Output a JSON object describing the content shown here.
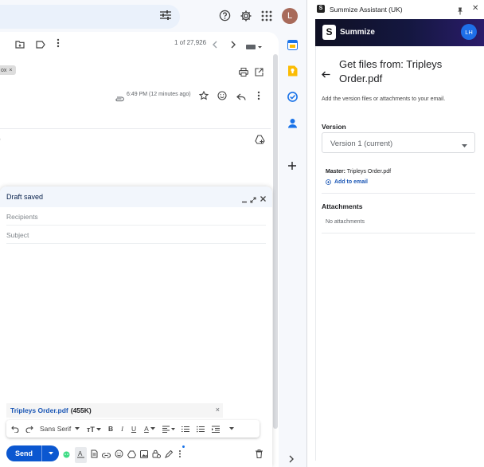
{
  "gmail": {
    "avatar_letter": "L",
    "pager": "1 of 27,926",
    "label_chip": "ox",
    "time": "6:49 PM (12 minutes ago)",
    "paren": ")"
  },
  "compose": {
    "title": "Draft saved",
    "recipients_placeholder": "Recipients",
    "subject_placeholder": "Subject",
    "attachment_name": "Tripleys Order.pdf",
    "attachment_size": "(455K)",
    "font_name": "Sans Serif",
    "send_label": "Send"
  },
  "panel": {
    "title": "Summize Assistant (UK)",
    "brand": "Summize",
    "user_initials": "LH",
    "heading": "Get files from: Tripleys Order.pdf",
    "hint": "Add the version files or attachments to your email.",
    "version_label": "Version",
    "version_value": "Version 1 (current)",
    "master_label": "Master:",
    "master_file": "Tripleys Order.pdf",
    "add_to_email": "Add to email",
    "attachments_label": "Attachments",
    "no_attachments": "No attachments"
  },
  "colors": {
    "send": "#0b57d0",
    "link": "#1a56b5",
    "banner_dark": "#141740",
    "banner_purple": "#2b1c6b",
    "avatar_gmail": "#a86a5a",
    "avatar_panel": "#1e6fe8"
  }
}
